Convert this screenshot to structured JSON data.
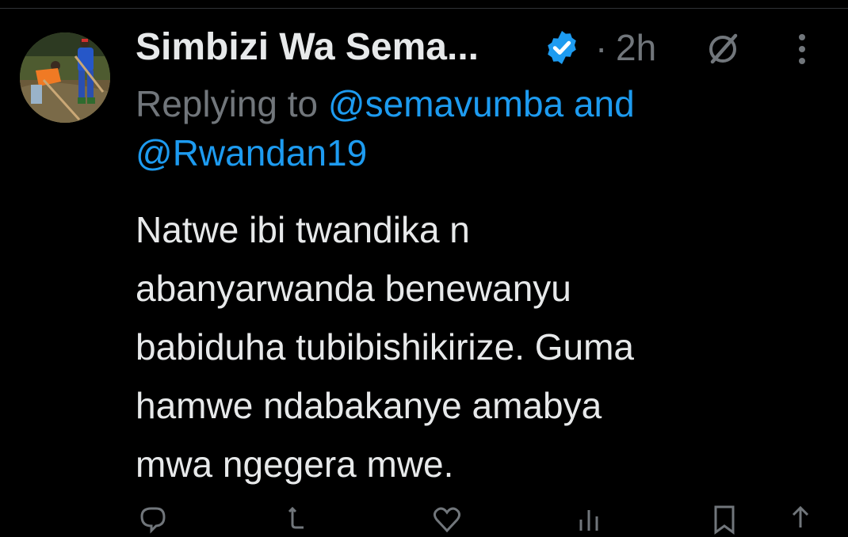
{
  "tweet": {
    "author_name": "Simbizi Wa Sema...",
    "separator": "·",
    "time": "2h",
    "reply_prefix": "Replying to",
    "mention_1": "@semavumba",
    "mention_joiner": "and",
    "mention_2": "@Rwandan19",
    "text": "Natwe ibi twandika n\nabanyarwanda benewanyu\nbabiduha tubibishikirize. Guma\nhamwe ndabakanye amabya\nmwa ngegera mwe."
  },
  "colors": {
    "background": "#000000",
    "text_primary": "#e7e9ea",
    "text_secondary": "#71767b",
    "link": "#1d9bf0",
    "verified_badge": "#1d9bf0"
  },
  "icons": {
    "verified": "verified-badge-icon",
    "grok": "grok-icon",
    "more": "more-vertical-icon",
    "reply": "reply-icon",
    "repost": "repost-icon",
    "like": "like-icon",
    "views": "views-icon",
    "bookmark": "bookmark-icon",
    "share": "share-icon"
  }
}
